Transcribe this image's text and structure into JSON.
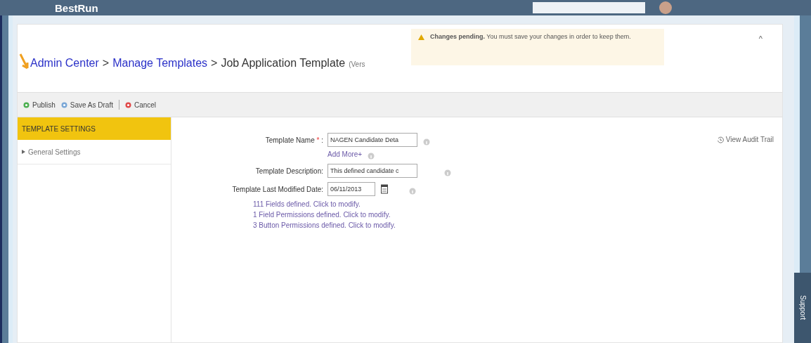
{
  "top_bar": {
    "logo": "BestRun"
  },
  "notification": {
    "text": "**Changes pending.** You must save your changes in order to keep them."
  },
  "breadcrumb": [
    {
      "label": "Admin Center",
      "kind": "link"
    },
    {
      "label": "Manage Templates",
      "kind": "link"
    },
    {
      "label": "Job Application Template",
      "kind": "current"
    }
  ],
  "breadcrumb_separator": ">",
  "version_note": "(Vers",
  "collapse_glyph": "^",
  "toolbar": [
    {
      "label": "Publish",
      "kind": "publish"
    },
    {
      "label": "Save As Draft",
      "kind": "draft"
    },
    {
      "label": "Cancel",
      "kind": "cancel"
    }
  ],
  "sidebar": {
    "header": "TEMPLATE SETTINGS",
    "items": [
      {
        "label": "General Settings",
        "expanded": false
      }
    ]
  },
  "audit_link": "View Audit Trail",
  "form": [
    {
      "label": "Template Name",
      "required": true,
      "value": "NAGEN Candidate Deta",
      "kind": "text",
      "extra_link": "Add More+"
    },
    {
      "label": "Template Description:",
      "required": false,
      "value": "This defined candidate c",
      "kind": "text"
    },
    {
      "label": "Template Last Modified Date:",
      "required": false,
      "value": "06/11/2013",
      "kind": "date"
    }
  ],
  "required_mark": "*",
  "required_colon": ":",
  "summary_links": [
    "111 Fields defined. Click to modify.",
    "1 Field Permissions defined. Click to modify.",
    "3 Button Permissions defined. Click to modify."
  ],
  "support_tab": "Support"
}
